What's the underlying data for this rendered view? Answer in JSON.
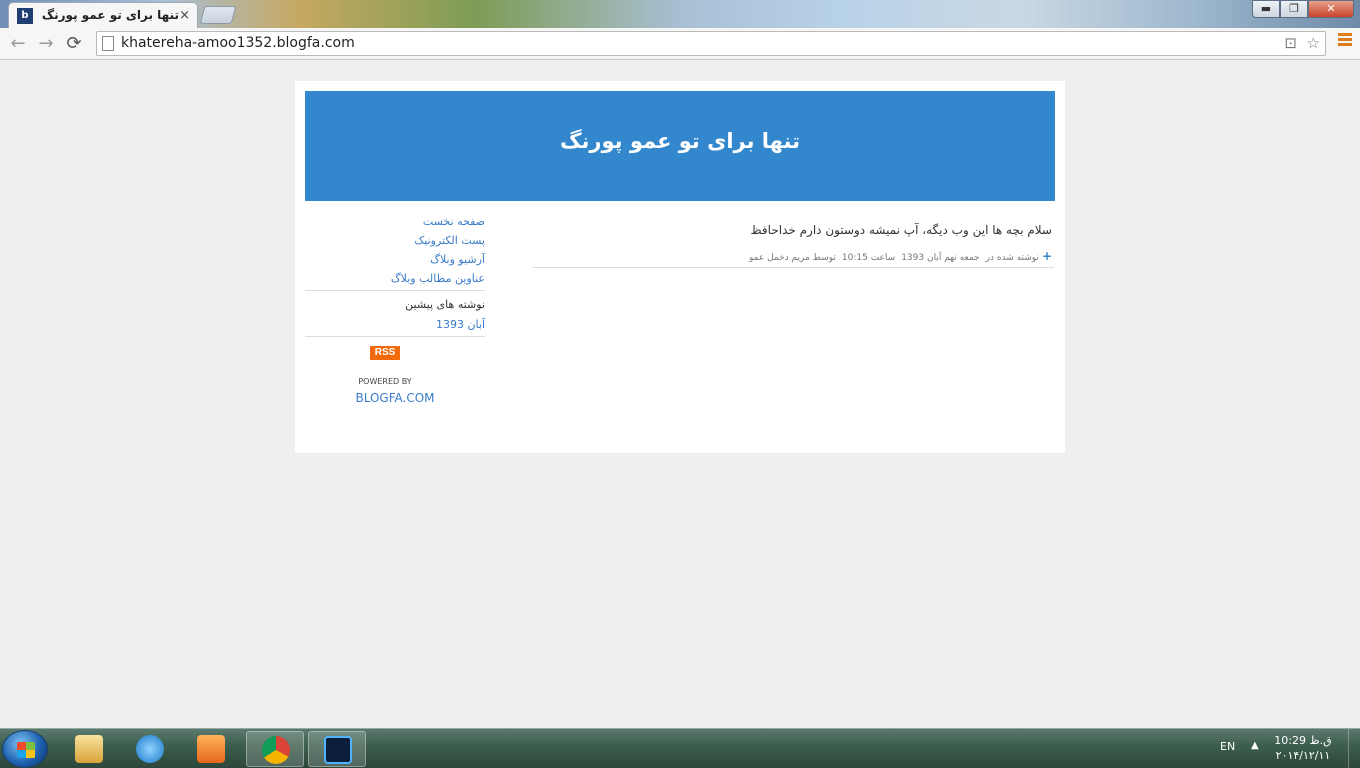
{
  "browser": {
    "tab_title": "تنها برای تو عمو پورنگ",
    "tab_close": "×",
    "url": "khatereha-amoo1352.blogfa.com",
    "window_buttons": {
      "minimize": "▬",
      "restore": "❐",
      "close": "✕"
    }
  },
  "blog": {
    "title": "تنها برای تو عمو پورنگ",
    "post": {
      "body": "سلام بچه ها این وب دیگه، آپ نمیشه دوستون دارم خداحافظ",
      "meta_plus": "+",
      "meta_posted": "نوشته شده در",
      "meta_date": "جمعه نهم آبان 1393",
      "meta_time": "ساعت 10:15",
      "meta_author": "توسط مریم دخمل عمو"
    },
    "sidebar": {
      "links": [
        "صفحه نخست",
        "پست الکترونیک",
        "آرشیو وبلاگ",
        "عناوین مطالب وبلاگ"
      ],
      "archive_heading": "نوشته های پیشین",
      "archive_links": [
        "آبان 1393"
      ],
      "rss": "RSS",
      "powered_by": "POWERED BY",
      "blogfa": "BLOGFA.COM"
    }
  },
  "taskbar": {
    "language": "EN",
    "clock_time": "10:29 ق.ظ",
    "clock_date": "۲۰۱۴/۱۲/۱۱"
  },
  "colors": {
    "header_blue": "#3387cc",
    "link_blue": "#3a7bc8",
    "rss_orange": "#f26a0c",
    "page_bg": "#efefef"
  },
  "icons": [
    "blogfa-favicon-icon",
    "back-icon",
    "forward-icon",
    "reload-icon",
    "page-icon",
    "translate-icon",
    "star-icon",
    "chrome-menu-icon",
    "windows-start-icon",
    "explorer-icon",
    "internet-explorer-icon",
    "media-player-icon",
    "chrome-icon",
    "photoshop-icon",
    "tray-arrow-icon"
  ]
}
